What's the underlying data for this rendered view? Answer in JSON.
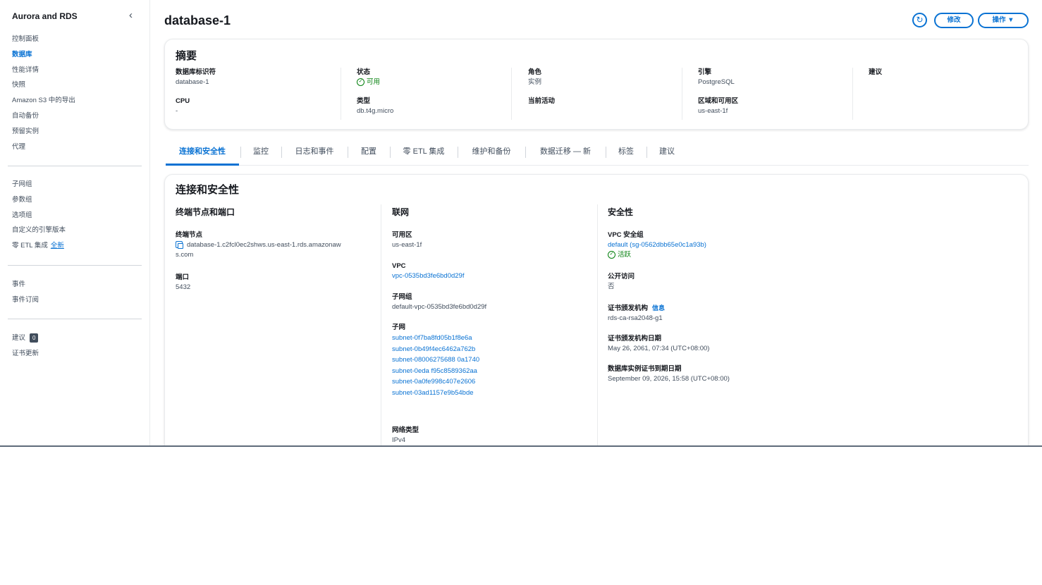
{
  "sidebar": {
    "title": "Aurora and RDS",
    "group1": [
      "控制面板",
      "数据库",
      "性能详情",
      "快照",
      "Amazon S3 中的导出",
      "自动备份",
      "预留实例",
      "代理"
    ],
    "group2": [
      "子网组",
      "参数组",
      "选项组",
      "自定义的引擎版本"
    ],
    "zero_etl": {
      "label": "零 ETL 集成",
      "link": "全新"
    },
    "group3": [
      "事件",
      "事件订阅"
    ],
    "recommendations": {
      "label": "建议",
      "badge": "0"
    },
    "cert_update": "证书更新"
  },
  "header": {
    "title": "database-1",
    "modify_label": "修改",
    "actions_label": "操作 ▼"
  },
  "summary": {
    "title": "摘要",
    "db_identifier": {
      "label": "数据库标识符",
      "value": "database-1"
    },
    "cpu": {
      "label": "CPU",
      "value": "-"
    },
    "status": {
      "label": "状态",
      "value": "可用"
    },
    "class": {
      "label": "类型",
      "value": "db.t4g.micro"
    },
    "role": {
      "label": "角色",
      "value": "实例"
    },
    "current_activity": {
      "label": "当前活动",
      "value": ""
    },
    "engine": {
      "label": "引擎",
      "value": "PostgreSQL"
    },
    "region_az": {
      "label": "区域和可用区",
      "value": "us-east-1f"
    },
    "recommendation": {
      "label": "建议",
      "value": ""
    }
  },
  "tabs": [
    "连接和安全性",
    "监控",
    "日志和事件",
    "配置",
    "零 ETL 集成",
    "维护和备份",
    "数据迁移 — 新",
    "标签",
    "建议"
  ],
  "connectivity": {
    "title": "连接和安全性",
    "endpoint_section": {
      "title": "终端节点和端口",
      "endpoint_label": "终端节点",
      "endpoint_value": "database-1.c2fcl0ec2shws.us-east-1.rds.amazonaw",
      "endpoint_value_cont": "s.com",
      "port_label": "端口",
      "port_value": "5432"
    },
    "network_section": {
      "title": "联网",
      "az_label": "可用区",
      "az_value": "us-east-1f",
      "vpc_label": "VPC",
      "vpc_value": "vpc-0535bd3fe6bd0d29f",
      "subnet_group_label": "子网组",
      "subnet_group_value": "default-vpc-0535bd3fe6bd0d29f",
      "subnets_label": "子网",
      "subnets": [
        "subnet-0f7ba8fd05b1f8e6a",
        "subnet-0b49f4ec6462a762b",
        "subnet-08006275688 0a1740",
        "subnet-0eda f95c8589362aa",
        "subnet-0a0fe998c407e2606",
        "subnet-03ad1157e9b54bde"
      ],
      "network_type_label": "网络类型",
      "network_type_value": "IPv4"
    },
    "security_section": {
      "title": "安全性",
      "sg_label": "VPC 安全组",
      "sg_value": "default (sg-0562dbb65e0c1a93b)",
      "sg_status": "活跃",
      "public_label": "公开访问",
      "public_value": "否",
      "ca_label": "证书颁发机构",
      "ca_info": "信息",
      "ca_value": "rds-ca-rsa2048-g1",
      "ca_date_label": "证书颁发机构日期",
      "ca_date_value": "May 26, 2061, 07:34 (UTC+08:00)",
      "db_cert_label": "数据库实例证书到期日期",
      "db_cert_value": "September 09, 2026, 15:58 (UTC+08:00)"
    }
  }
}
